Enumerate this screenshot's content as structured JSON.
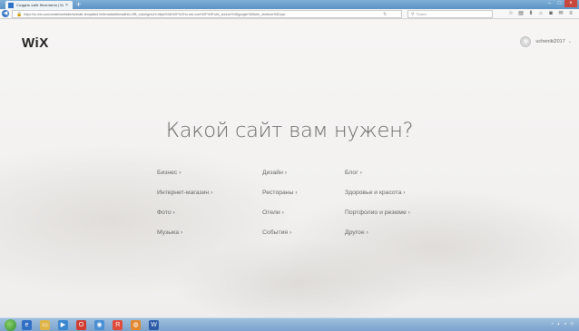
{
  "browser": {
    "tab_title": "Создать сайт бесплатно | Ко",
    "tab_close": "×",
    "new_tab": "+",
    "url": "https://ru.wix.com/create/website/website-templates?referralAdditionalInfo=HB_ru&originUrl=https%3A%2F%2Fru.wix.com%2F%3Futm_source%3Dgoogle%26utm_medium%3Dcpc",
    "search_placeholder": "Поиск",
    "minimize": "–",
    "maximize": "□",
    "close": "×"
  },
  "header": {
    "logo": "WiX",
    "username": "ucheniki2017",
    "chevron": "⌄"
  },
  "main": {
    "headline": "Какой сайт вам нужен?",
    "categories": [
      [
        "Бизнес ›",
        "Дизайн ›",
        "Блог ›"
      ],
      [
        "Интернет-магазин ›",
        "Рестораны ›",
        "Здоровье и красота ›"
      ],
      [
        "Фото ›",
        "Отели ›",
        "Портфолио и резюме ›"
      ],
      [
        "Музыка ›",
        "События ›",
        "Другое ›"
      ]
    ]
  },
  "colors": {
    "page_bg": "#f3f2f1",
    "headline": "#6a6a6a",
    "link": "#666666",
    "taskbar": "#8eb2d6"
  },
  "icons": {
    "back": "back-arrow-icon",
    "lock": "lock-icon",
    "reload": "reload-icon",
    "search": "search-icon",
    "toolbar": [
      "star-icon",
      "reading-list-icon",
      "download-icon",
      "home-icon",
      "pocket-icon",
      "chat-icon",
      "menu-icon"
    ],
    "taskbar_apps": [
      "ie-icon",
      "folder-icon",
      "media-icon",
      "opera-icon",
      "chrome-icon",
      "yandex-icon",
      "firefox-icon",
      "word-icon"
    ]
  }
}
